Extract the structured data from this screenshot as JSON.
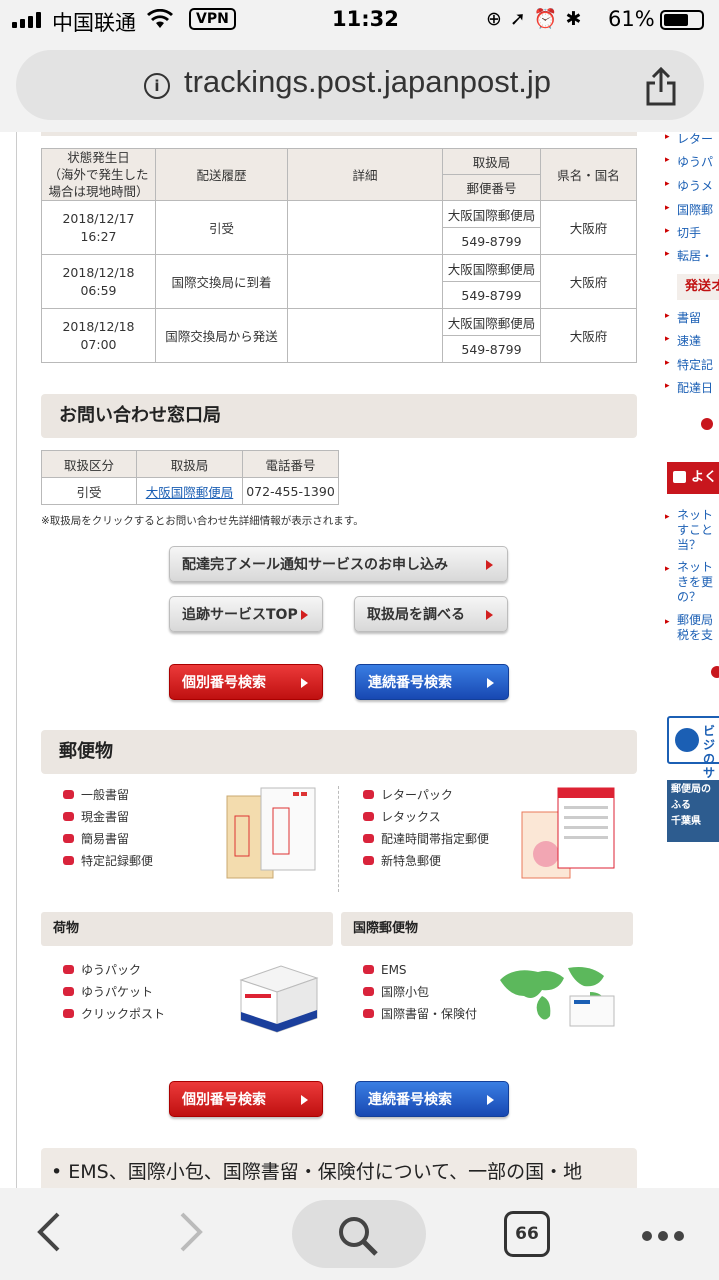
{
  "status_bar": {
    "carrier": "中国联通",
    "vpn": "VPN",
    "time": "11:32",
    "battery": "61%"
  },
  "url_bar": {
    "url": "trackings.post.japanpost.jp"
  },
  "history_table": {
    "headers": {
      "date": "状態発生日\n（海外で発生した\n場合は現地時間）",
      "history": "配送履歴",
      "detail": "詳細",
      "office": "取扱局",
      "postal": "郵便番号",
      "pref": "県名・国名"
    },
    "rows": [
      {
        "date": "2018/12/17\n16:27",
        "history": "引受",
        "detail": "",
        "office": "大阪国際郵便局",
        "postal": "549-8799",
        "pref": "大阪府"
      },
      {
        "date": "2018/12/18\n06:59",
        "history": "国際交換局に到着",
        "detail": "",
        "office": "大阪国際郵便局",
        "postal": "549-8799",
        "pref": "大阪府"
      },
      {
        "date": "2018/12/18\n07:00",
        "history": "国際交換局から発送",
        "detail": "",
        "office": "大阪国際郵便局",
        "postal": "549-8799",
        "pref": "大阪府"
      }
    ]
  },
  "contact": {
    "title": "お問い合わせ窓口局",
    "headers": [
      "取扱区分",
      "取扱局",
      "電話番号"
    ],
    "row": {
      "kind": "引受",
      "office": "大阪国際郵便局",
      "phone": "072-455-1390"
    },
    "note": "※取扱局をクリックするとお問い合わせ先詳細情報が表示されます。"
  },
  "buttons": {
    "mail_service": "配達完了メール通知サービスのお申し込み",
    "tracking_top": "追跡サービスTOP",
    "find_office": "取扱局を調べる",
    "individual": "個別番号検索",
    "sequential": "連続番号検索"
  },
  "mail": {
    "title": "郵便物",
    "left_items": [
      "一般書留",
      "現金書留",
      "簡易書留",
      "特定記録郵便"
    ],
    "right_items": [
      "レターパック",
      "レタックス",
      "配達時間帯指定郵便",
      "新特急郵便"
    ]
  },
  "parcel": {
    "title": "荷物",
    "items": [
      "ゆうパック",
      "ゆうパケット",
      "クリックポスト"
    ]
  },
  "international": {
    "title": "国際郵便物",
    "items": [
      "EMS",
      "国際小包",
      "国際書留・保険付"
    ]
  },
  "notice": {
    "text": "• EMS、国際小包、国際書留・保険付について、一部の国・地"
  },
  "right_column": {
    "links_top": [
      "レター",
      "ゆうパ",
      "ゆうメ",
      "国際郵",
      "切手",
      "転居・"
    ],
    "heading": "発送オ",
    "links_mid": [
      "書留",
      "速達",
      "特定記",
      "配達日"
    ],
    "faq_heading": "よくあ",
    "faq_items": [
      "ネット\nすこと\n当？",
      "ネット\nきを更\nの？",
      "郵便局\n税を支"
    ],
    "biz_text": "ビジ\nのサ",
    "banner_text": "郵便局の\nふる\n千葉県"
  },
  "toolbar": {
    "tabs_count": "66"
  },
  "colors": {
    "accent_red": "#d21f1f",
    "accent_blue": "#1b5fb4",
    "header_beige": "#ebe6e1"
  }
}
